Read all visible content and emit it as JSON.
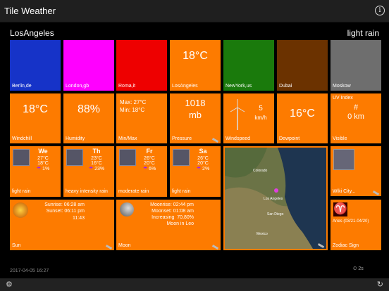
{
  "app": {
    "title": "Tile Weather",
    "info_icon": "info-icon"
  },
  "header": {
    "city": "LosAngeles",
    "condition": "light rain"
  },
  "color_tiles": [
    {
      "label": "Berlin,de",
      "color": "#1633c8"
    },
    {
      "label": "London,gb",
      "color": "#ff00ff"
    },
    {
      "label": "Roma,it",
      "color": "#ee0000"
    },
    {
      "label": "LosAngeles",
      "value": "18°C",
      "color": "#fd7b00"
    },
    {
      "label": "NewYork,us",
      "color": "#1a7a0c"
    },
    {
      "label": "Dubai",
      "color": "#6b3200"
    },
    {
      "label": "Moskow",
      "color": "#6e6e6e"
    }
  ],
  "row2": {
    "windchill": {
      "value": "18°C",
      "label": "Windchill"
    },
    "humidity": {
      "value": "88%",
      "label": "Humidity"
    },
    "minmax": {
      "max": "Max: 27°C",
      "min": "Min: 18°C",
      "label": "Min/Max"
    },
    "pressure": {
      "value": "1018",
      "unit": "mb",
      "label": "Pressure"
    },
    "wind": {
      "value": "5",
      "unit": "km/h",
      "label": "Windspeed"
    },
    "dewpoint": {
      "value": "16°C",
      "label": "Dewpoint"
    },
    "uv": {
      "title": "UV Index",
      "value": "#",
      "visible": "0 km",
      "label": "Visible"
    }
  },
  "forecast": [
    {
      "day": "We",
      "hi": "27°C",
      "lo": "18°C",
      "rain": "1%",
      "label": "light rain"
    },
    {
      "day": "Th",
      "hi": "23°C",
      "lo": "16°C",
      "rain": "23%",
      "label": "heavy intensity rain"
    },
    {
      "day": "Fr",
      "hi": "26°C",
      "lo": "20°C",
      "rain": "6%",
      "label": "moderate rain"
    },
    {
      "day": "Sa",
      "hi": "26°C",
      "lo": "20°C",
      "rain": "2%",
      "label": "light rain"
    }
  ],
  "map": {
    "places": [
      "Colorado",
      "Los Angeles",
      "San Diego",
      "Mexico"
    ]
  },
  "wiki": {
    "label": "Wiki City..."
  },
  "sun": {
    "sunrise": "Sunrise: 06:28 am",
    "sunset": "Sunset: 06:11 pm",
    "length": "11:43",
    "label": "Sun"
  },
  "moon": {
    "moonrise": "Moonrise: 02:44 pm",
    "moonset": "Moonset: 01:08 am",
    "increasing": "Increasing",
    "percent": "70,80%",
    "phase": "Moon in Leo",
    "label": "Moon"
  },
  "zodiac": {
    "sign": "Aries (03/21-04/20)",
    "label": "Zodiac Sign"
  },
  "footer": {
    "date": "2017-04-05 16:27",
    "timer": "2s"
  }
}
